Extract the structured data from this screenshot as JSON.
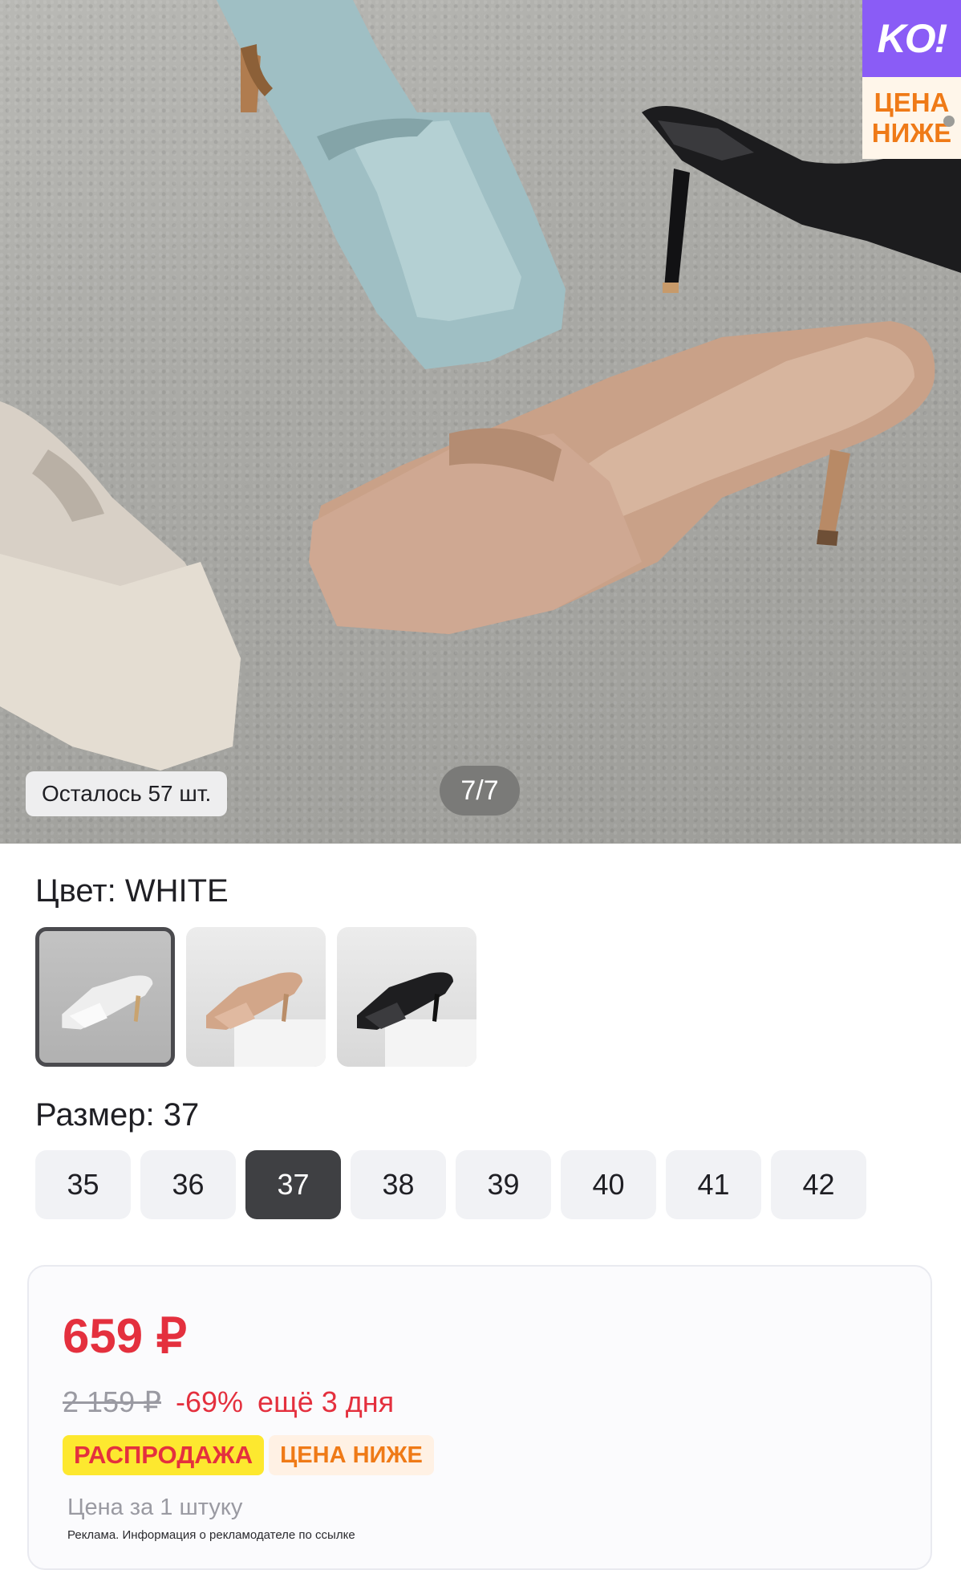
{
  "promo_sticker": {
    "logo": "KO!",
    "line1": "ЦЕНА",
    "line2": "НИЖЕ"
  },
  "gallery": {
    "stock_text": "Осталось 57 шт.",
    "counter": "7/7"
  },
  "color": {
    "label": "Цвет: WHITE",
    "options": [
      {
        "name": "white",
        "selected": true
      },
      {
        "name": "beige",
        "selected": false
      },
      {
        "name": "black",
        "selected": false
      }
    ]
  },
  "size": {
    "label": "Размер: 37",
    "options": [
      "35",
      "36",
      "37",
      "38",
      "39",
      "40",
      "41",
      "42"
    ],
    "selected": "37"
  },
  "price": {
    "current": "659 ₽",
    "old": "2 159 ₽",
    "discount": "-69%",
    "time_left": "ещё 3 дня",
    "badge_sale": "РАСПРОДАЖА",
    "badge_lower": "ЦЕНА НИЖЕ",
    "per_unit": "Цена за 1 штуку",
    "ad_note": "Реклама. Информация о рекламодателе по ссылке"
  },
  "colors": {
    "price_red": "#e4303e",
    "promo_purple": "#8a5cf6",
    "promo_orange": "#ef7a17",
    "sale_yellow": "#fde82f",
    "selected_dark": "#3f4043"
  }
}
